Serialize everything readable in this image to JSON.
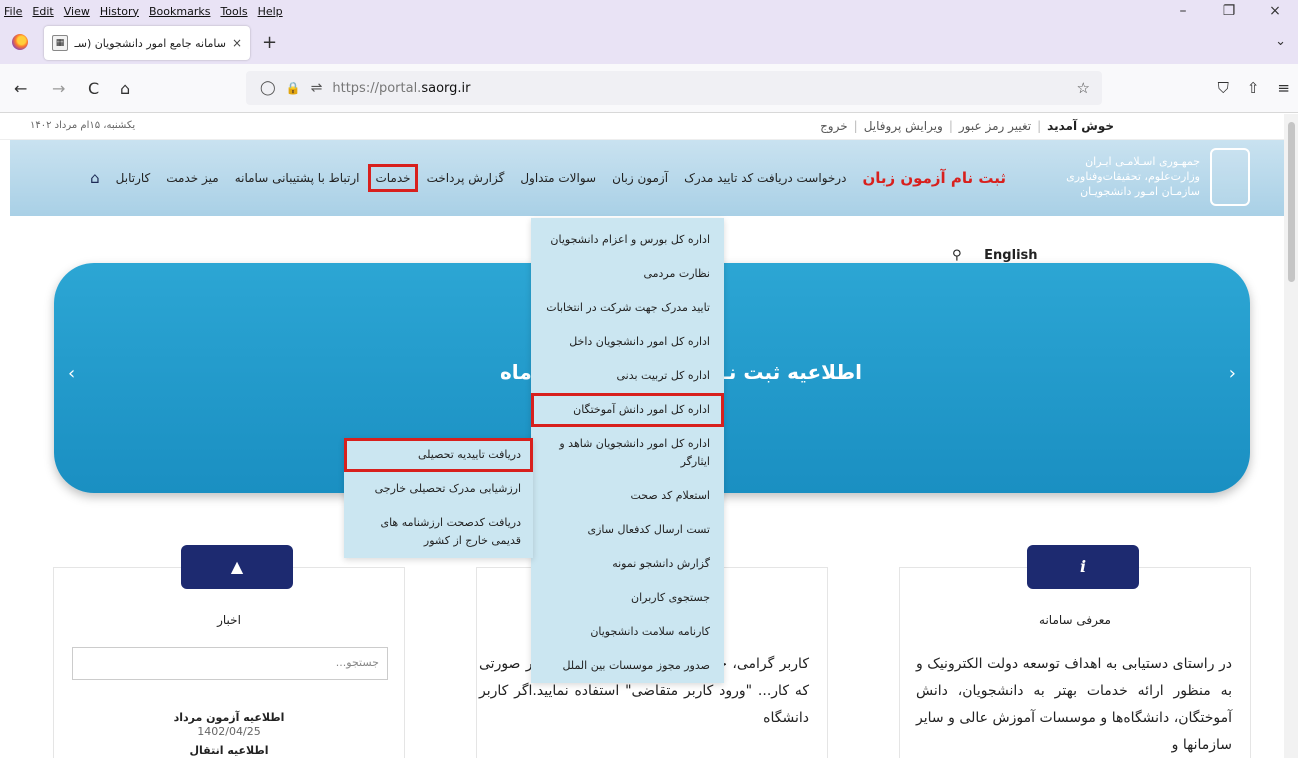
{
  "menubar": {
    "items": [
      "File",
      "Edit",
      "View",
      "History",
      "Bookmarks",
      "Tools",
      "Help"
    ]
  },
  "window_controls": {
    "minimize": "–",
    "restore": "❐",
    "close": "×"
  },
  "tab": {
    "title": "سامانه جامع امور دانشجویان (سـ",
    "close": "×",
    "new_tab": "+",
    "list_all": "⌄"
  },
  "nav": {
    "back": "←",
    "forward": "→",
    "reload": "C",
    "home": "⌂",
    "shield": "◯",
    "lock": "🔒",
    "perm": "⇌",
    "url_prefix": "https://portal.",
    "url_domain": "saorg.ir",
    "bookmark_star": "☆",
    "pocket": "⛉",
    "extensions": "⇧",
    "app_menu": "≡"
  },
  "userbar": {
    "date": "یکشنبه، ۱۵ام مرداد ۱۴۰۲",
    "welcome": "خوش آمدید",
    "change_password": "تغییر رمز عبور",
    "edit_profile": "ویرایش پروفایل",
    "logout": "خروج",
    "separator": "|"
  },
  "header": {
    "logo_text_line1": "جمهـوری اسـلامـی ایـران",
    "logo_text_line2": "وزارت‌علوم، تحقیقات‌وفناوری",
    "logo_text_line3": "سازمـان امـور دانشجویـان",
    "logo_mark": "سازمان امور دانشجویان"
  },
  "mainnav": {
    "home": "⌂",
    "items": [
      "کارتابل",
      "میز خدمت",
      "ارتباط با پشتیبانی سامانه",
      "خدمات",
      "گزارش پرداخت",
      "سوالات متداول",
      "آزمون زبان",
      "درخواست دریافت کد تایید مدرک"
    ],
    "cta": "ثبت نام آزمون زبان"
  },
  "search_english": {
    "icon": "⚲",
    "label": "English"
  },
  "banner": {
    "title_right": "اطلاعیه ثبت نـ",
    "title_left": "ـد ماه",
    "prev": "‹",
    "next": "›"
  },
  "dropdown": {
    "items": [
      "اداره کل بورس و اعزام دانشجویان",
      "نظارت مردمی",
      "تایید مدرک جهت شرکت در انتخابات",
      "اداره کل امور دانشجویان داخل",
      "اداره کل تربیت بدنی",
      "اداره کل امور دانش آموختگان",
      "اداره کل امور دانشجویان شاهد و ایثارگر",
      "استعلام کد صحت",
      "تست ارسال کدفعال سازی",
      "گزارش دانشجو نمونه",
      "جستجوی کاربران",
      "کارنامه سلامت دانشجویان",
      "صدور مجوز موسسات بین الملل"
    ]
  },
  "submenu": {
    "items": [
      "دریافت تاییدیه تحصیلی",
      "ارزشیابی مدرک تحصیلی خارجی",
      "دریافت کدصحت ارزشنامه های قدیمی خارج از کشور"
    ]
  },
  "panels": {
    "news": {
      "icon": "📣",
      "title": "اخبار",
      "search_placeholder": "جستجو...",
      "item_title": "اطلاعیه آزمون مرداد",
      "item_date": "1402/04/25",
      "item_next": "اطلاعیه انتقال"
    },
    "middle": {
      "icon": "",
      "text": "کاربر گرامی، جـ ... ابتدا یکبار ثبت نام ... وید.در صورتی که کار... \"ورود کاربر متقاضی\" استفاده نمایید.اگر کاربر دانشگاه"
    },
    "about": {
      "icon": "i",
      "title": "معرفی سامانه",
      "text": "در راستای دستیابی به اهداف توسعه دولت الکترونیک و به منظور ارائه خدمات بهتر به دانشجویان، دانش آموختگان، دانشگاه‌ها و موسسات آموزش عالی و سایر سازمانها و"
    }
  }
}
